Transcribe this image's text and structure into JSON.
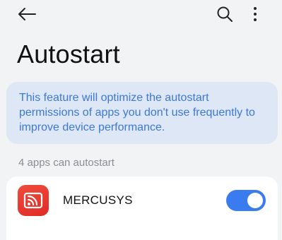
{
  "header": {
    "back_icon": "arrow-left-icon",
    "search_icon": "search-icon",
    "more_icon": "more-vertical-icon",
    "title": "Autostart"
  },
  "info_card": {
    "text": "This feature will optimize the autostart permissions of apps you don't use frequently to improve device performance."
  },
  "apps_section": {
    "label": "4 apps can autostart",
    "apps": [
      {
        "name": "MERCUSYS",
        "icon": "mercusys-app-icon",
        "autostart_enabled": true
      }
    ]
  },
  "colors": {
    "accent": "#3a7cf0",
    "info_bg": "#dde7f5",
    "info_text": "#3e78d6",
    "app_icon_bg": "#e12c25",
    "page_bg": "#f1f3f5"
  }
}
